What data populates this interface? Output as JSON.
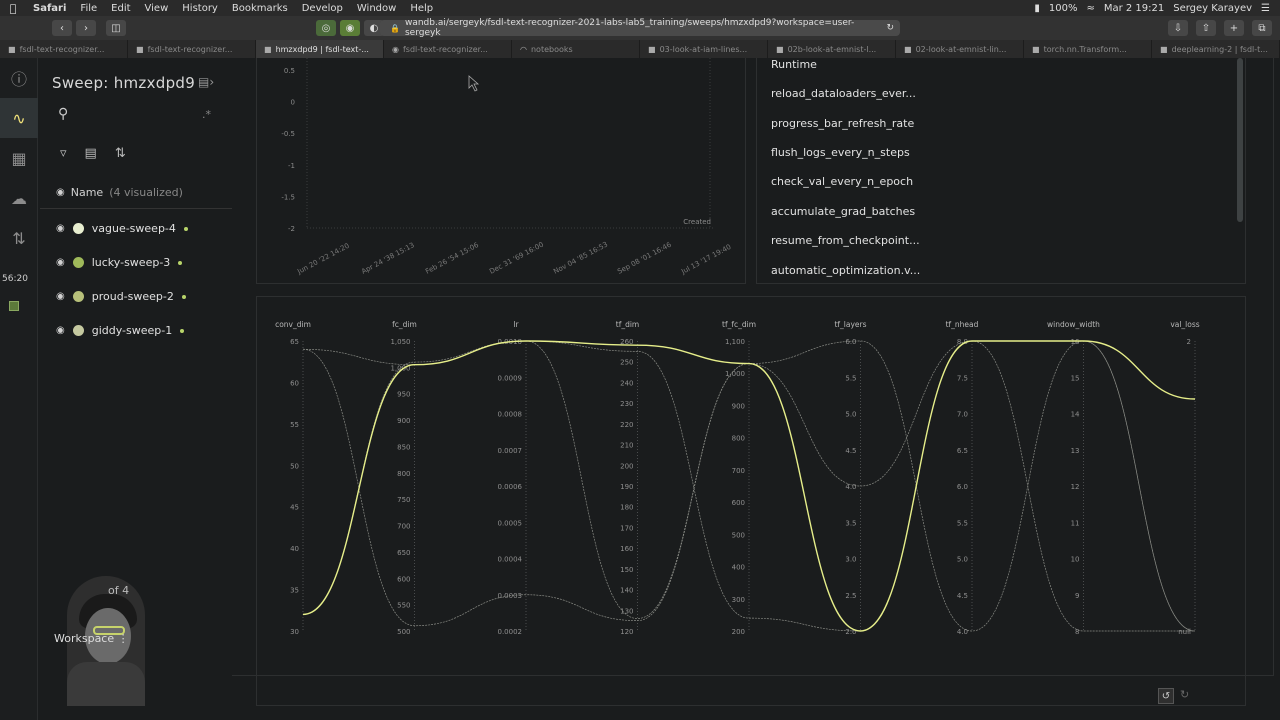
{
  "menubar": {
    "app": "Safari",
    "items": [
      "File",
      "Edit",
      "View",
      "History",
      "Bookmarks",
      "Develop",
      "Window",
      "Help"
    ],
    "battery": "100%",
    "datetime": "Mar 2  19:21",
    "user": "Sergey Karayev"
  },
  "browser": {
    "url": "wandb.ai/sergeyk/fsdl-text-recognizer-2021-labs-lab5_training/sweeps/hmzxdpd9?workspace=user-sergeyk",
    "tabs": [
      {
        "label": "fsdl-text-recognizer..."
      },
      {
        "label": "fsdl-text-recognizer..."
      },
      {
        "label": "hmzxdpd9 | fsdl-text-..."
      },
      {
        "label": "fsdl-text-recognizer..."
      },
      {
        "label": "notebooks"
      },
      {
        "label": "03-look-at-iam-lines..."
      },
      {
        "label": "02b-look-at-emnist-l..."
      },
      {
        "label": "02-look-at-emnist-lin..."
      },
      {
        "label": "torch.nn.Transform..."
      },
      {
        "label": "deeplearning-2 | fsdl-t..."
      }
    ]
  },
  "rail": {
    "time": "56:20"
  },
  "sidebar": {
    "title": "Sweep: hmzxdpd9",
    "name_header": "Name",
    "visualized": "(4 visualized)",
    "runs": [
      {
        "name": "vague-sweep-4",
        "color": "#e8eed0"
      },
      {
        "name": "lucky-sweep-3",
        "color": "#9fb95a"
      },
      {
        "name": "proud-sweep-2",
        "color": "#b7c07a"
      },
      {
        "name": "giddy-sweep-1",
        "color": "#c5c9a0"
      }
    ],
    "page": "of 4",
    "workspace": "Workspace"
  },
  "params": [
    "Runtime",
    "reload_dataloaders_ever...",
    "progress_bar_refresh_rate",
    "flush_logs_every_n_steps",
    "check_val_every_n_epoch",
    "accumulate_grad_batches",
    "resume_from_checkpoint...",
    "automatic_optimization.v..."
  ],
  "chart_data": [
    {
      "type": "scatter",
      "title": "",
      "xlabel": "Created",
      "ylabel": "",
      "y_ticks": [
        "0.5",
        "0",
        "-0.5",
        "-1",
        "-1.5",
        "-2"
      ],
      "ylim": [
        -2,
        0.5
      ],
      "x_ticks": [
        "Jun 20 '22 14:20",
        "Apr 24 '38 15:13",
        "Feb 26 '54 15:06",
        "Dec 31 '69 16:00",
        "Nov 04 '85 16:53",
        "Sep 08 '01 16:46",
        "Jul 13 '17 19:40"
      ],
      "series": []
    },
    {
      "type": "parallel_coordinates",
      "axes": [
        {
          "label": "conv_dim",
          "ticks": [
            "65",
            "60",
            "55",
            "50",
            "45",
            "40",
            "35",
            "30"
          ],
          "min": 30,
          "max": 65
        },
        {
          "label": "fc_dim",
          "ticks": [
            "1,050",
            "1,000",
            "950",
            "900",
            "850",
            "800",
            "750",
            "700",
            "650",
            "600",
            "550",
            "500"
          ],
          "min": 500,
          "max": 1050
        },
        {
          "label": "lr",
          "ticks": [
            "0.0010",
            "0.0009",
            "0.0008",
            "0.0007",
            "0.0006",
            "0.0005",
            "0.0004",
            "0.0003",
            "0.0002"
          ],
          "min": 0.0002,
          "max": 0.001
        },
        {
          "label": "tf_dim",
          "ticks": [
            "260",
            "250",
            "240",
            "230",
            "220",
            "210",
            "200",
            "190",
            "180",
            "170",
            "160",
            "150",
            "140",
            "130",
            "120"
          ],
          "min": 120,
          "max": 260
        },
        {
          "label": "tf_fc_dim",
          "ticks": [
            "1,100",
            "1,000",
            "900",
            "800",
            "700",
            "600",
            "500",
            "400",
            "300",
            "200"
          ],
          "min": 200,
          "max": 1100
        },
        {
          "label": "tf_layers",
          "ticks": [
            "6.0",
            "5.5",
            "5.0",
            "4.5",
            "4.0",
            "3.5",
            "3.0",
            "2.5",
            "2.0"
          ],
          "min": 2,
          "max": 6
        },
        {
          "label": "tf_nhead",
          "ticks": [
            "8.0",
            "7.5",
            "7.0",
            "6.5",
            "6.0",
            "5.5",
            "5.0",
            "4.5",
            "4.0"
          ],
          "min": 4,
          "max": 8
        },
        {
          "label": "window_width",
          "ticks": [
            "16",
            "15",
            "14",
            "13",
            "12",
            "11",
            "10",
            "9",
            "8"
          ],
          "min": 8,
          "max": 16
        },
        {
          "label": "val_loss",
          "ticks": [
            "2",
            "null"
          ],
          "min": 0,
          "max": 3
        }
      ],
      "series": [
        {
          "values": [
            32,
            1005,
            0.001,
            258,
            1030,
            2,
            8,
            16,
            2.4
          ],
          "color": "#e6ee8a",
          "highlight": true
        },
        {
          "values": [
            64,
            510,
            0.0003,
            125,
            1030,
            4,
            8,
            16,
            null
          ],
          "color": "#8a8c86",
          "highlight": false
        },
        {
          "values": [
            32,
            1010,
            0.001,
            255,
            240,
            2,
            8,
            8,
            null
          ],
          "color": "#8a8c86",
          "highlight": false
        },
        {
          "values": [
            64,
            1005,
            0.001,
            126,
            1030,
            6,
            4,
            16,
            null
          ],
          "color": "#8a8c86",
          "highlight": false
        }
      ]
    }
  ]
}
